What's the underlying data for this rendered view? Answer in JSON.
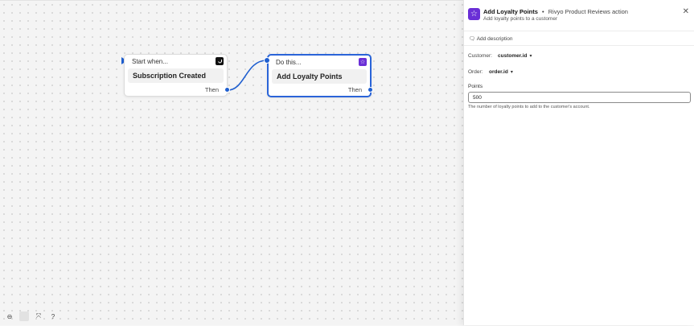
{
  "trigger_node": {
    "header": "Start when...",
    "title": "Subscription Created",
    "then_label": "Then",
    "app_icon": "j-logo-icon"
  },
  "action_node": {
    "header": "Do this...",
    "title": "Add Loyalty Points",
    "then_label": "Then",
    "app_icon": "star-badge-icon"
  },
  "colors": {
    "accent": "#1f5fd0",
    "app_purple": "#6a2fd6",
    "selected_border": "#2a64d8"
  },
  "canvas_controls": {
    "zoom_out_icon": "zoom-out-icon",
    "zoom_in_icon": "zoom-in-icon",
    "fit_icon": "fit-view-icon",
    "help_icon": "help-icon"
  },
  "panel": {
    "title": "Add Loyalty Points",
    "separator": "•",
    "app_name": "Rivyo Product Reviews action",
    "subtitle": "Add loyalty points to a customer",
    "add_description": "Add description",
    "customer": {
      "label": "Customer:",
      "value": "customer.id"
    },
    "order": {
      "label": "Order:",
      "value": "order.id"
    },
    "points": {
      "label": "Points",
      "value": "500",
      "help": "The number of loyalty points to add to the customer's account."
    }
  }
}
